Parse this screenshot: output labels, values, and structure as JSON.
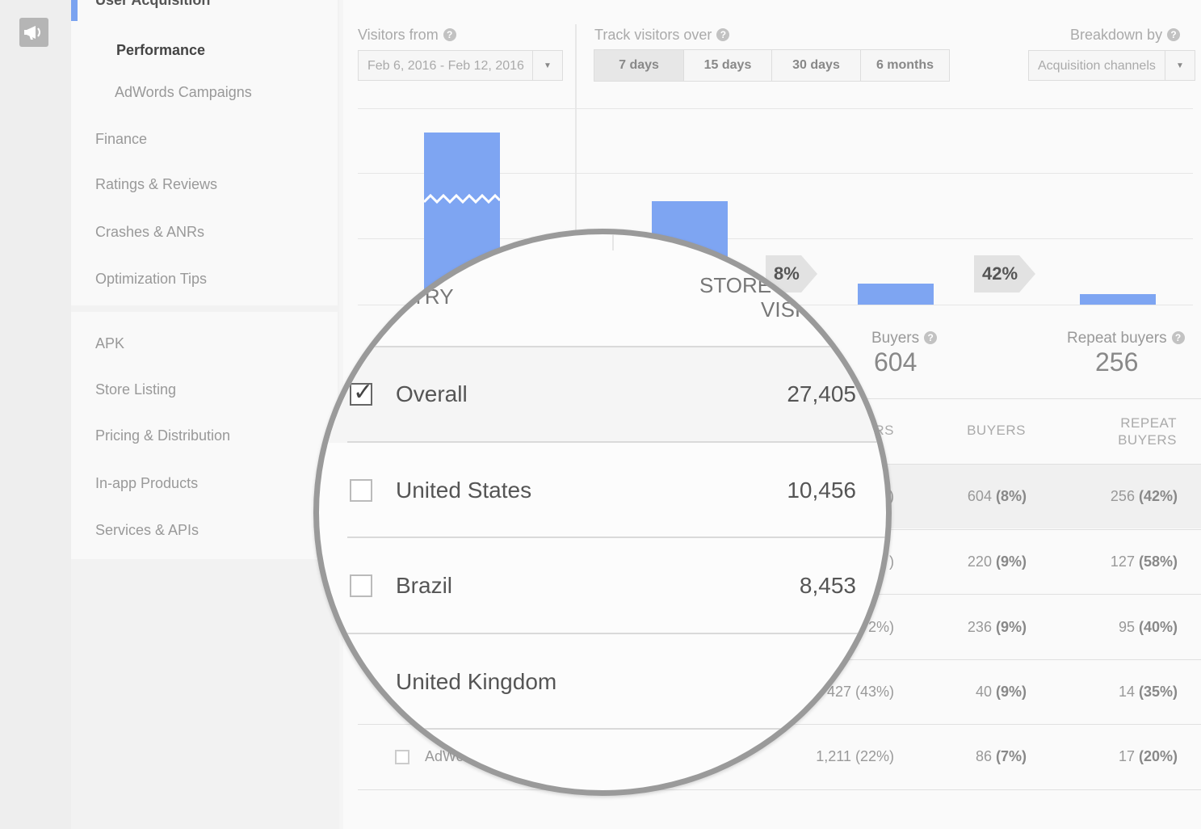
{
  "sidebar": {
    "section_title": "User Acquisition",
    "items": [
      {
        "label": "Performance"
      },
      {
        "label": "AdWords Campaigns"
      },
      {
        "label": "Finance"
      },
      {
        "label": "Ratings & Reviews"
      },
      {
        "label": "Crashes & ANRs"
      },
      {
        "label": "Optimization Tips"
      },
      {
        "label": "APK"
      },
      {
        "label": "Store Listing"
      },
      {
        "label": "Pricing & Distribution"
      },
      {
        "label": "In-app Products"
      },
      {
        "label": "Services & APIs"
      }
    ]
  },
  "controls": {
    "visitors_from_label": "Visitors from",
    "date_range": "Feb 6, 2016 - Feb 12, 2016",
    "track_label": "Track visitors over",
    "track_options": [
      "7 days",
      "15 days",
      "30 days",
      "6 months"
    ],
    "track_selected": "7 days",
    "breakdown_label": "Breakdown by",
    "breakdown_value": "Acquisition channels"
  },
  "funnel": {
    "labels": {
      "store_visitors_fragment": "STORE",
      "store_visitors_fragment2": "VISI",
      "country_fragment": "TRY"
    },
    "arrows": [
      "8%",
      "42%"
    ],
    "buyers_label": "Buyers",
    "buyers_value": "604",
    "repeat_label": "Repeat buyers",
    "repeat_value": "256",
    "bar_heights": [
      1.0,
      0.6,
      0.12,
      0.06
    ]
  },
  "table": {
    "headers": {
      "visitors_fragment": "RS",
      "buyers": "BUYERS",
      "repeat_line1": "REPEAT",
      "repeat_line2": "BUYERS"
    },
    "rows": [
      {
        "visitors_frag": ")",
        "buyers": "604",
        "buyers_pct": "(8%)",
        "repeat": "256",
        "repeat_pct": "(42%)"
      },
      {
        "visitors_frag": ")",
        "buyers": "220",
        "buyers_pct": "(9%)",
        "repeat": "127",
        "repeat_pct": "(58%)"
      },
      {
        "visitors_frag": "2%)",
        "buyers": "236",
        "buyers_pct": "(9%)",
        "repeat": "95",
        "repeat_pct": "(40%)"
      },
      {
        "visitors_frag": "427 (43%)",
        "buyers": "40",
        "buyers_pct": "(9%)",
        "repeat": "14",
        "repeat_pct": "(35%)"
      },
      {
        "visitors_frag": "1,211 (22%)",
        "buyers": "86",
        "buyers_pct": "(7%)",
        "repeat": "17",
        "repeat_pct": "(20%)"
      }
    ],
    "adwords_frag": "AdWo"
  },
  "magnified": {
    "rows": [
      {
        "name": "Overall",
        "value": "27,405",
        "checked": true
      },
      {
        "name": "United States",
        "value": "10,456",
        "checked": false
      },
      {
        "name": "Brazil",
        "value": "8,453",
        "checked": false
      },
      {
        "name": "United Kingdom",
        "value": "",
        "checked": false
      }
    ]
  }
}
